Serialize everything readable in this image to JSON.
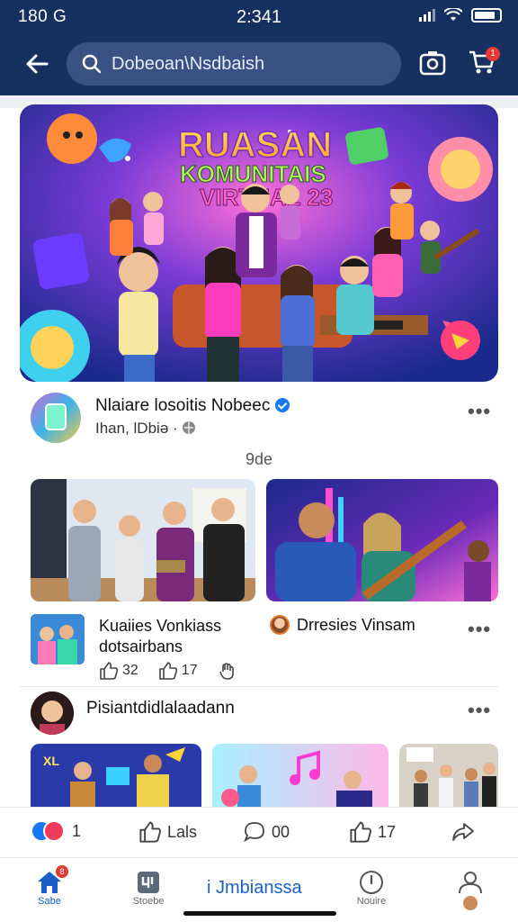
{
  "status_bar": {
    "left": "180 G",
    "time": "2:341"
  },
  "search": {
    "placeholder": "Dobeoan\\Nsdbaish"
  },
  "cart": {
    "badge": "1"
  },
  "hero": {
    "title_line1": "RUASAN",
    "title_line2": "KOMUNITAIS",
    "title_line3": "VIRTUAL 23"
  },
  "post": {
    "title": "Nlaiare losoitis Nobeec",
    "subtitle": "Ihan, lDbiə ·",
    "more": "•••",
    "center_label": "9de"
  },
  "cards": [
    {
      "title": "Kuaiies Vonkiass dotsairbans",
      "reactions": [
        "32",
        "17",
        ""
      ]
    },
    {
      "title": "Drresies Vinsam",
      "more": "•••"
    }
  ],
  "section": {
    "title": "Pisiantdidlalaadann",
    "more": "•••"
  },
  "actions": {
    "react_count": "1",
    "like": "Lals",
    "comment": "00",
    "share_count": "17"
  },
  "nav": {
    "home": "Sabe",
    "store": "Stoebe",
    "center": "i Jmbianssa",
    "notif": "Nouire",
    "home_badge": "8"
  },
  "colors": {
    "header": "#16305f",
    "accent": "#1a5fc7",
    "badge": "#e53935"
  }
}
